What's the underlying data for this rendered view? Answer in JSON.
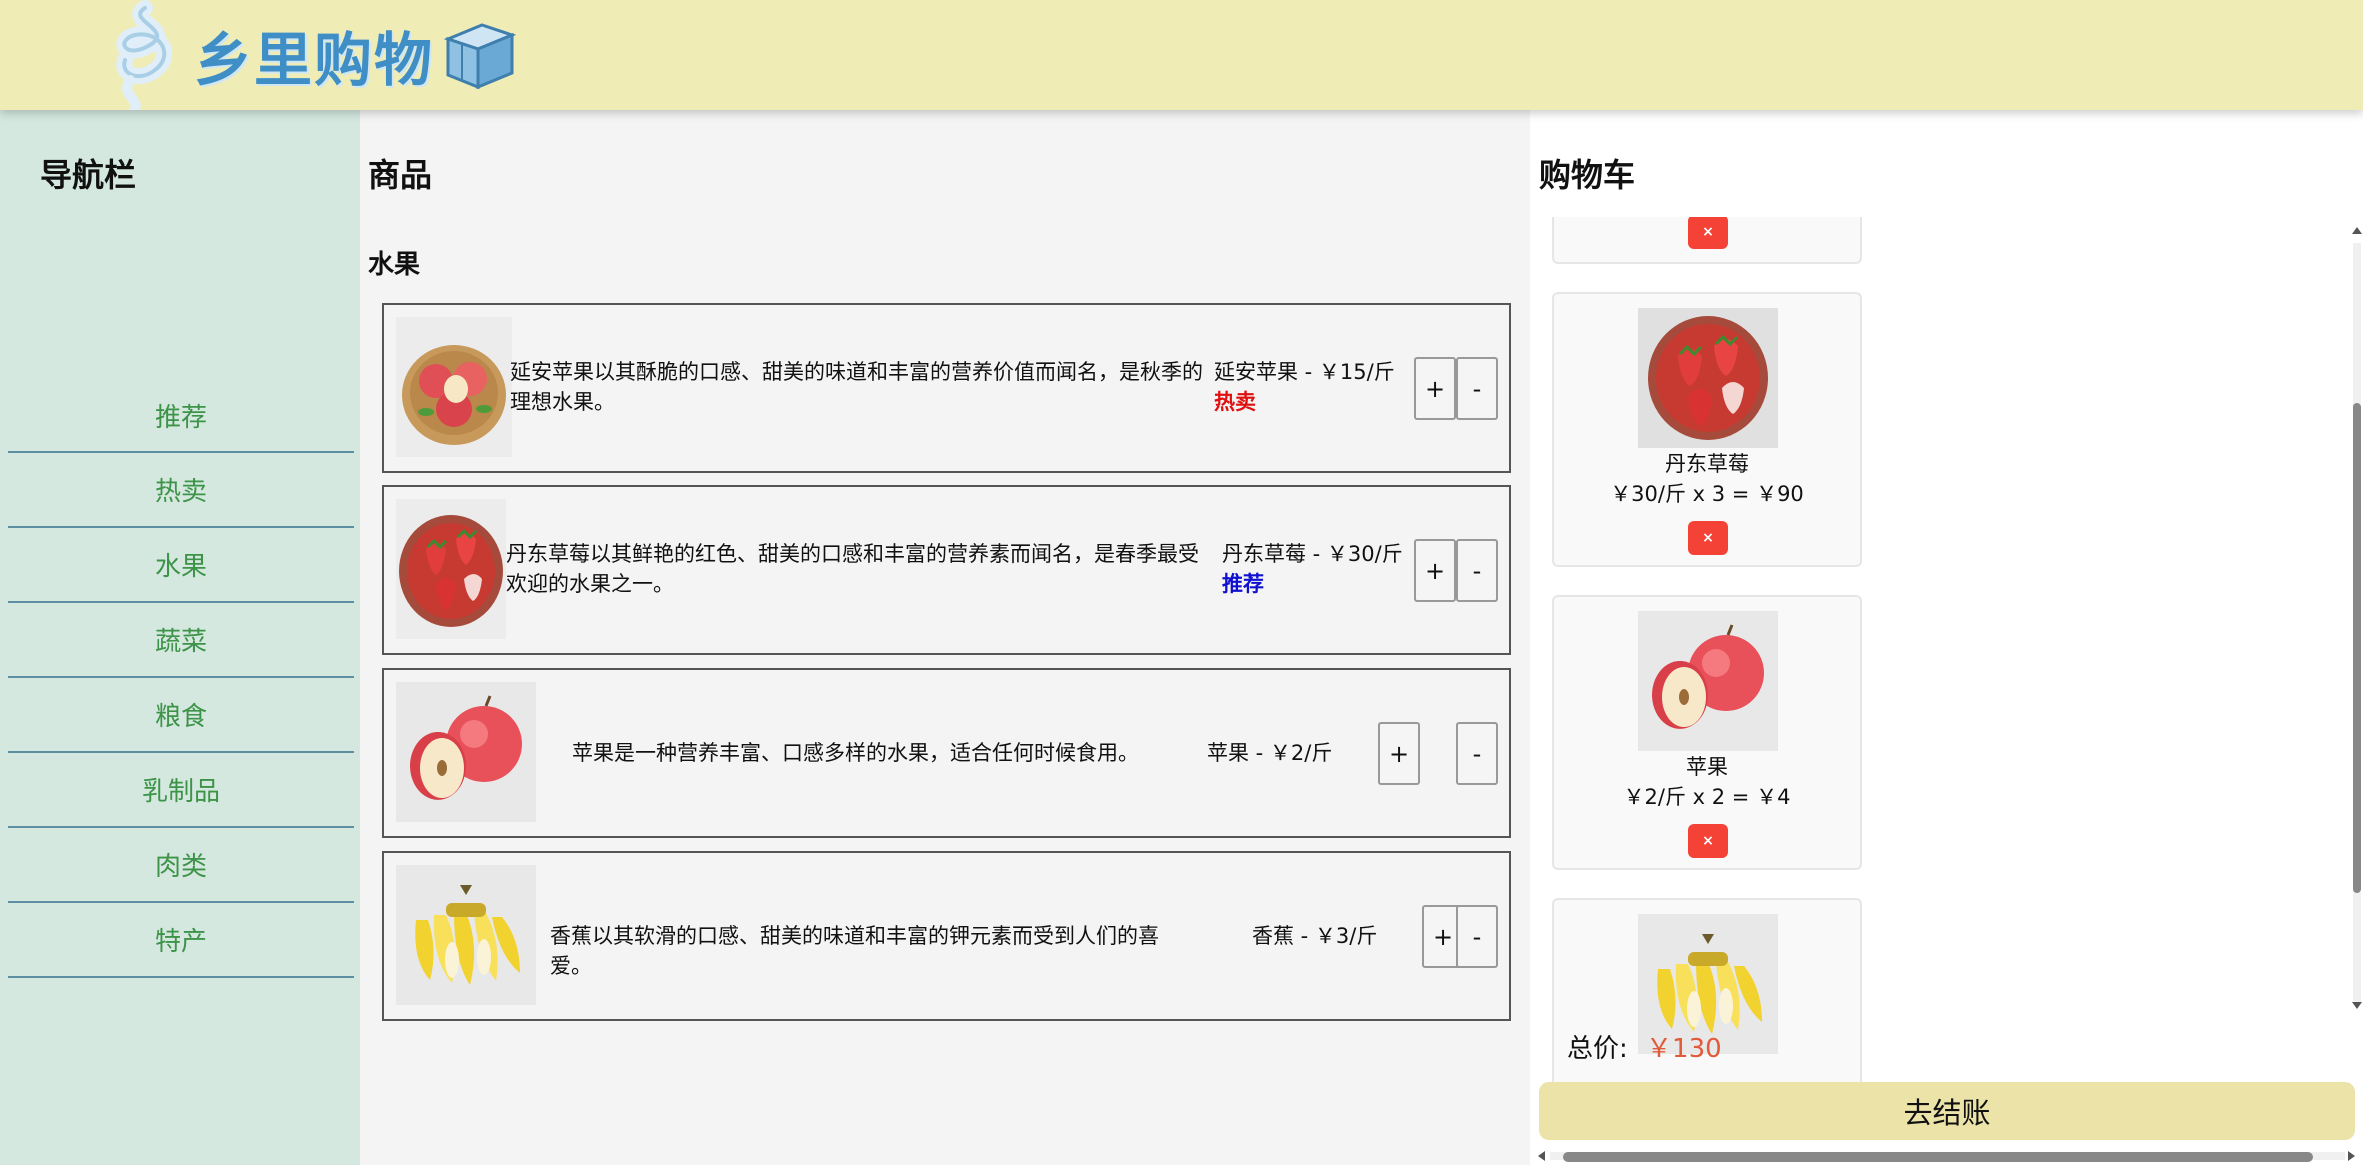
{
  "header": {
    "logo_text": "乡里购物",
    "logo_swirl_icon": "swirl-logo-icon",
    "logo_box_icon": "box-icon"
  },
  "sidebar": {
    "title": "导航栏",
    "items": [
      {
        "label": "推荐"
      },
      {
        "label": "热卖"
      },
      {
        "label": "水果"
      },
      {
        "label": "蔬菜"
      },
      {
        "label": "粮食"
      },
      {
        "label": "乳制品"
      },
      {
        "label": "肉类"
      },
      {
        "label": "特产"
      }
    ]
  },
  "products": {
    "title": "商品",
    "category": "水果",
    "items": [
      {
        "image": "apple-basket-image",
        "desc": "延安苹果以其酥脆的口感、甜美的味道和丰富的营养价值而闻名，是秋季的理想水果。",
        "name_price": "延安苹果 - ￥15/斤",
        "badge": "热卖",
        "badge_color": "#e01010",
        "plus": "+",
        "minus": "-"
      },
      {
        "image": "strawberry-bowl-image",
        "desc": "丹东草莓以其鲜艳的红色、甜美的口感和丰富的营养素而闻名，是春季最受欢迎的水果之一。",
        "name_price": "丹东草莓 - ￥30/斤",
        "badge": "推荐",
        "badge_color": "#1010d0",
        "plus": "+",
        "minus": "-"
      },
      {
        "image": "apple-image",
        "desc": "苹果是一种营养丰富、口感多样的水果，适合任何时候食用。",
        "name_price": "苹果 - ￥2/斤",
        "badge": "",
        "plus": "+",
        "minus": "-"
      },
      {
        "image": "banana-image",
        "desc": "香蕉以其软滑的口感、甜美的味道和丰富的钾元素而受到人们的喜爱。",
        "name_price": "香蕉 - ￥3/斤",
        "badge": "",
        "plus": "+",
        "minus": "-"
      }
    ]
  },
  "cart": {
    "title": "购物车",
    "items": [
      {
        "name": "",
        "line": "",
        "remove": "×"
      },
      {
        "image": "strawberry-bowl-image",
        "name": "丹东草莓",
        "line": "￥30/斤 x 3 = ￥90",
        "remove": "×"
      },
      {
        "image": "apple-image",
        "name": "苹果",
        "line": "￥2/斤 x 2 = ￥4",
        "remove": "×"
      },
      {
        "image": "banana-image",
        "name": "",
        "line": ""
      }
    ],
    "total_label": "总价:",
    "total_value": "￥130",
    "checkout_label": "去结账"
  },
  "colors": {
    "header_bg": "#efedb5",
    "sidebar_bg": "#d4e8e0",
    "nav_text": "#3d9347",
    "remove_btn": "#f44336",
    "total_amount": "#e15a3a",
    "checkout_bg": "#ece3a8"
  }
}
